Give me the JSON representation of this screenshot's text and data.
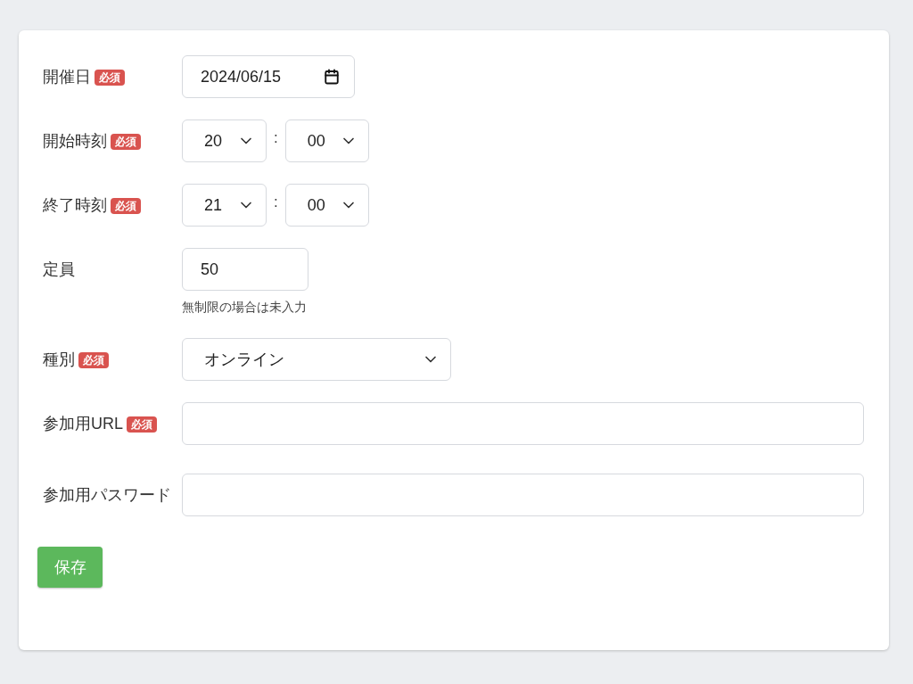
{
  "fields": [
    {
      "kind": "date",
      "label": "開催日",
      "badge": "必須",
      "value": "2024/06/15"
    },
    {
      "kind": "time",
      "label": "開始時刻",
      "badge": "必須",
      "hour": "20",
      "separator": ":",
      "minute": "00"
    },
    {
      "kind": "time",
      "label": "終了時刻",
      "badge": "必須",
      "hour": "21",
      "separator": ":",
      "minute": "00"
    },
    {
      "kind": "number",
      "label": "定員",
      "value": "50",
      "help": "無制限の場合は未入力"
    },
    {
      "kind": "select",
      "label": "種別",
      "badge": "必須",
      "value": "オンライン"
    },
    {
      "kind": "text",
      "label": "参加用URL",
      "badge": "必須"
    },
    {
      "kind": "text",
      "label": "参加用パスワード"
    }
  ],
  "save_button": "保存"
}
